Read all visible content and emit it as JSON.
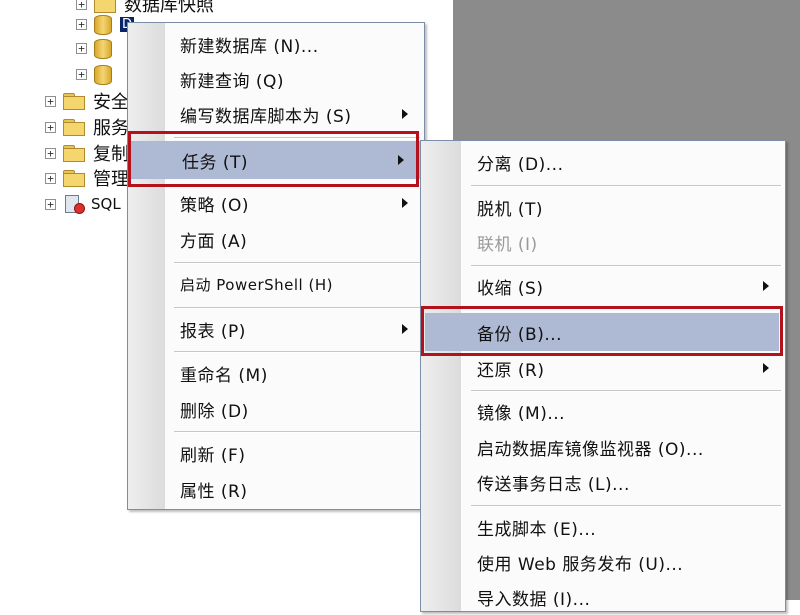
{
  "tree": {
    "items": [
      {
        "label": "数据库快照"
      },
      {
        "label": "D"
      },
      {
        "label": ""
      },
      {
        "label": ""
      },
      {
        "label": "安全"
      },
      {
        "label": "服务"
      },
      {
        "label": "复制"
      },
      {
        "label": "管理"
      },
      {
        "label": "SQL"
      }
    ]
  },
  "context_menu": {
    "items": [
      {
        "label": "新建数据库 (N)..."
      },
      {
        "label": "新建查询 (Q)"
      },
      {
        "label": "编写数据库脚本为 (S)"
      },
      {
        "label": "任务 (T)"
      },
      {
        "label": "策略 (O)"
      },
      {
        "label": "方面 (A)"
      },
      {
        "label": "启动 PowerShell (H)"
      },
      {
        "label": "报表 (P)"
      },
      {
        "label": "重命名 (M)"
      },
      {
        "label": "删除 (D)"
      },
      {
        "label": "刷新 (F)"
      },
      {
        "label": "属性 (R)"
      }
    ]
  },
  "submenu": {
    "items": [
      {
        "label": "分离 (D)..."
      },
      {
        "label": "脱机 (T)"
      },
      {
        "label": "联机 (I)",
        "disabled": true
      },
      {
        "label": "收缩 (S)"
      },
      {
        "label": "备份 (B)..."
      },
      {
        "label": "还原 (R)"
      },
      {
        "label": "镜像 (M)..."
      },
      {
        "label": "启动数据库镜像监视器 (O)..."
      },
      {
        "label": "传送事务日志 (L)..."
      },
      {
        "label": "生成脚本 (E)..."
      },
      {
        "label": "使用 Web 服务发布 (U)..."
      },
      {
        "label": "导入数据 (I)..."
      }
    ]
  },
  "colors": {
    "highlight": "#aeb9d3",
    "callout_border": "#b3121d"
  }
}
